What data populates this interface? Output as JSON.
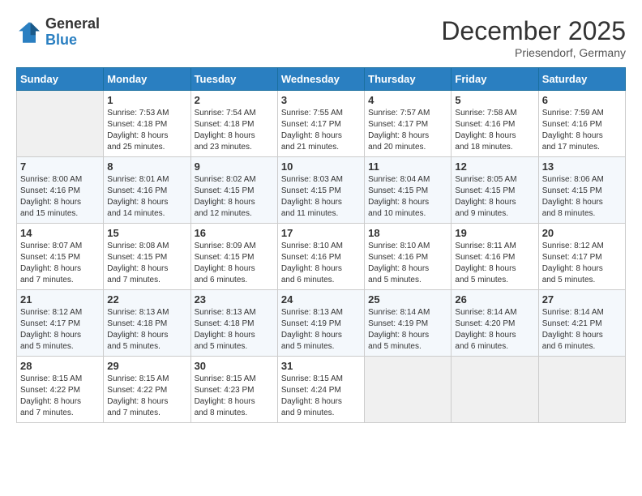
{
  "header": {
    "logo_general": "General",
    "logo_blue": "Blue",
    "month_title": "December 2025",
    "location": "Priesendorf, Germany"
  },
  "weekdays": [
    "Sunday",
    "Monday",
    "Tuesday",
    "Wednesday",
    "Thursday",
    "Friday",
    "Saturday"
  ],
  "weeks": [
    [
      {
        "day": "",
        "info": ""
      },
      {
        "day": "1",
        "info": "Sunrise: 7:53 AM\nSunset: 4:18 PM\nDaylight: 8 hours\nand 25 minutes."
      },
      {
        "day": "2",
        "info": "Sunrise: 7:54 AM\nSunset: 4:18 PM\nDaylight: 8 hours\nand 23 minutes."
      },
      {
        "day": "3",
        "info": "Sunrise: 7:55 AM\nSunset: 4:17 PM\nDaylight: 8 hours\nand 21 minutes."
      },
      {
        "day": "4",
        "info": "Sunrise: 7:57 AM\nSunset: 4:17 PM\nDaylight: 8 hours\nand 20 minutes."
      },
      {
        "day": "5",
        "info": "Sunrise: 7:58 AM\nSunset: 4:16 PM\nDaylight: 8 hours\nand 18 minutes."
      },
      {
        "day": "6",
        "info": "Sunrise: 7:59 AM\nSunset: 4:16 PM\nDaylight: 8 hours\nand 17 minutes."
      }
    ],
    [
      {
        "day": "7",
        "info": "Sunrise: 8:00 AM\nSunset: 4:16 PM\nDaylight: 8 hours\nand 15 minutes."
      },
      {
        "day": "8",
        "info": "Sunrise: 8:01 AM\nSunset: 4:16 PM\nDaylight: 8 hours\nand 14 minutes."
      },
      {
        "day": "9",
        "info": "Sunrise: 8:02 AM\nSunset: 4:15 PM\nDaylight: 8 hours\nand 12 minutes."
      },
      {
        "day": "10",
        "info": "Sunrise: 8:03 AM\nSunset: 4:15 PM\nDaylight: 8 hours\nand 11 minutes."
      },
      {
        "day": "11",
        "info": "Sunrise: 8:04 AM\nSunset: 4:15 PM\nDaylight: 8 hours\nand 10 minutes."
      },
      {
        "day": "12",
        "info": "Sunrise: 8:05 AM\nSunset: 4:15 PM\nDaylight: 8 hours\nand 9 minutes."
      },
      {
        "day": "13",
        "info": "Sunrise: 8:06 AM\nSunset: 4:15 PM\nDaylight: 8 hours\nand 8 minutes."
      }
    ],
    [
      {
        "day": "14",
        "info": "Sunrise: 8:07 AM\nSunset: 4:15 PM\nDaylight: 8 hours\nand 7 minutes."
      },
      {
        "day": "15",
        "info": "Sunrise: 8:08 AM\nSunset: 4:15 PM\nDaylight: 8 hours\nand 7 minutes."
      },
      {
        "day": "16",
        "info": "Sunrise: 8:09 AM\nSunset: 4:15 PM\nDaylight: 8 hours\nand 6 minutes."
      },
      {
        "day": "17",
        "info": "Sunrise: 8:10 AM\nSunset: 4:16 PM\nDaylight: 8 hours\nand 6 minutes."
      },
      {
        "day": "18",
        "info": "Sunrise: 8:10 AM\nSunset: 4:16 PM\nDaylight: 8 hours\nand 5 minutes."
      },
      {
        "day": "19",
        "info": "Sunrise: 8:11 AM\nSunset: 4:16 PM\nDaylight: 8 hours\nand 5 minutes."
      },
      {
        "day": "20",
        "info": "Sunrise: 8:12 AM\nSunset: 4:17 PM\nDaylight: 8 hours\nand 5 minutes."
      }
    ],
    [
      {
        "day": "21",
        "info": "Sunrise: 8:12 AM\nSunset: 4:17 PM\nDaylight: 8 hours\nand 5 minutes."
      },
      {
        "day": "22",
        "info": "Sunrise: 8:13 AM\nSunset: 4:18 PM\nDaylight: 8 hours\nand 5 minutes."
      },
      {
        "day": "23",
        "info": "Sunrise: 8:13 AM\nSunset: 4:18 PM\nDaylight: 8 hours\nand 5 minutes."
      },
      {
        "day": "24",
        "info": "Sunrise: 8:13 AM\nSunset: 4:19 PM\nDaylight: 8 hours\nand 5 minutes."
      },
      {
        "day": "25",
        "info": "Sunrise: 8:14 AM\nSunset: 4:19 PM\nDaylight: 8 hours\nand 5 minutes."
      },
      {
        "day": "26",
        "info": "Sunrise: 8:14 AM\nSunset: 4:20 PM\nDaylight: 8 hours\nand 6 minutes."
      },
      {
        "day": "27",
        "info": "Sunrise: 8:14 AM\nSunset: 4:21 PM\nDaylight: 8 hours\nand 6 minutes."
      }
    ],
    [
      {
        "day": "28",
        "info": "Sunrise: 8:15 AM\nSunset: 4:22 PM\nDaylight: 8 hours\nand 7 minutes."
      },
      {
        "day": "29",
        "info": "Sunrise: 8:15 AM\nSunset: 4:22 PM\nDaylight: 8 hours\nand 7 minutes."
      },
      {
        "day": "30",
        "info": "Sunrise: 8:15 AM\nSunset: 4:23 PM\nDaylight: 8 hours\nand 8 minutes."
      },
      {
        "day": "31",
        "info": "Sunrise: 8:15 AM\nSunset: 4:24 PM\nDaylight: 8 hours\nand 9 minutes."
      },
      {
        "day": "",
        "info": ""
      },
      {
        "day": "",
        "info": ""
      },
      {
        "day": "",
        "info": ""
      }
    ]
  ]
}
